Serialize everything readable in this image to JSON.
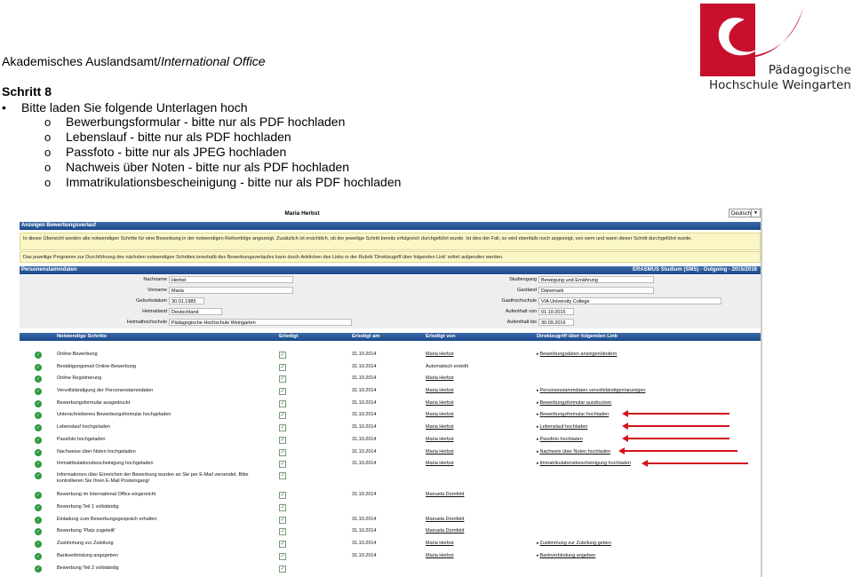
{
  "slide": {
    "office_prefix": "Akademisches Auslandsamt/",
    "office_italic": "International Office",
    "step_title": "Schritt 8",
    "intro": "Bitte laden Sie folgende Unterlagen hoch",
    "bullet_glyph": "•",
    "sub_glyph": "o",
    "items": [
      "Bewerbungsformular  - bitte nur als PDF hochladen",
      "Lebenslauf - bitte nur als PDF hochladen",
      "Passfoto - bitte nur als JPEG hochladen",
      "Nachweis über Noten - bitte nur als PDF hochladen",
      "Immatrikulationsbescheinigung - bitte nur als PDF hochladen"
    ]
  },
  "logo": {
    "line1": "Pädagogische",
    "line2": "Hochschule Weingarten",
    "color": "#c8102e"
  },
  "portal": {
    "user_name": "Maria Herbst",
    "language": "Deutsch",
    "section_title": "Anzeigen Bewerbungsverlauf",
    "info1": "In dieser Übersicht werden alle notwendigen Schritte für eine Bewerbung in der notwendigen Reihenfolge angezeigt. Zusätzlich ist ersichtlich, ob der jeweilige Schritt bereits erfolgreich durchgeführt wurde. Ist dies der Fall, so wird ebenfalls noch angezeigt, von wem und wann dieser Schritt durchgeführt wurde.",
    "info2": "Das jeweilige Programm zur Durchführung des nächsten notwendigen Schrittes innerhalb des Bewerbungsverlaufes kann durch Anklicken des Links in der Rubrik 'Direktzugriff über folgenden Link' sofort aufgerufen werden.",
    "person_header": "Personenstammdaten",
    "program_header": "ERASMUS Studium (SMS) - Outgoing - 2015/2016",
    "fields_left": [
      {
        "label": "Nachname",
        "value": "Herbst"
      },
      {
        "label": "Vorname",
        "value": "Maria"
      },
      {
        "label": "Geburtsdatum",
        "value": "30.01.1985"
      },
      {
        "label": "Heimatland",
        "value": "Deutschland"
      },
      {
        "label": "Heimathochschule",
        "value": "Pädagogische Hochschule Weingarten"
      }
    ],
    "fields_right": [
      {
        "label": "Studiengang",
        "value": "Bewegung und Ernährung"
      },
      {
        "label": "Gastland",
        "value": "Dänemark"
      },
      {
        "label": "Gasthochschule",
        "value": "VIA University College"
      },
      {
        "label": "Aufenthalt von",
        "value": "01.10.2015"
      },
      {
        "label": "Aufenthalt bis",
        "value": "30.09.2016"
      }
    ],
    "columns": {
      "step": "Notwendige Schritte",
      "done": "Erledigt",
      "done_on": "Erledigt am",
      "done_by": "Erledigt von",
      "link": "Direktzugriff über folgenden Link"
    },
    "ok_glyph": "✓",
    "check_glyph": "✓",
    "rows": [
      {
        "step": "Online-Bewerbung",
        "date": "31.10.2014",
        "by": "Maria Herbst",
        "link": "Bewerbungsdaten anzeigen/ändern"
      },
      {
        "step": "Bestätigungsmail Online-Bewerbung",
        "date": "31.10.2014",
        "by": "Automatisch erstellt",
        "link": ""
      },
      {
        "step": "Online Registrierung",
        "date": "31.10.2014",
        "by": "Maria Herbst",
        "link": ""
      },
      {
        "step": "Vervollständigung der Personenstammdaten",
        "date": "31.10.2014",
        "by": "Maria Herbst",
        "link": "Personenstammdaten vervollständigen/anzeigen"
      },
      {
        "step": "Bewerbungsformular ausgedruckt",
        "date": "31.10.2014",
        "by": "Maria Herbst",
        "link": "Bewerbungsformular ausdrucken"
      },
      {
        "step": "Unterschriebenes Bewerbungsformular hochgeladen",
        "date": "31.10.2014",
        "by": "Maria Herbst",
        "link": "Bewerbungsformular hochladen"
      },
      {
        "step": "Lebenslauf hochgeladen",
        "date": "31.10.2014",
        "by": "Maria Herbst",
        "link": "Lebenslauf hochladen"
      },
      {
        "step": "Passfoto hochgeladen",
        "date": "31.10.2014",
        "by": "Maria Herbst",
        "link": "Passfoto hochladen"
      },
      {
        "step": "Nachweise über Noten hochgeladen",
        "date": "31.10.2014",
        "by": "Maria Herbst",
        "link": "Nachweis über Noten hochladen"
      },
      {
        "step": "Immatrikulationsbescheinigung hochgeladen",
        "date": "31.10.2014",
        "by": "Maria Herbst",
        "link": "Immatrikulationsbescheinigung hochladen"
      },
      {
        "step": "Informationen über Einreichen der Bewerbung wurden an Sie per E-Mail versendet. Bitte kontrollieren Sie Ihren E-Mail Posteingang!",
        "date": "",
        "by": "",
        "link": ""
      },
      {
        "step": "Bewerbung im International Office eingereicht",
        "date": "31.10.2014",
        "by": "Manuela Dornfeld",
        "link": ""
      },
      {
        "step": "Bewerbung Teil 1 vollständig",
        "date": "",
        "by": "",
        "link": ""
      },
      {
        "step": "Einladung zum Bewerbungsgespräch erhalten",
        "date": "31.10.2014",
        "by": "Manuela Dornfeld",
        "link": ""
      },
      {
        "step": "Bewerbung 'Platz zugeteilt'",
        "date": "31.10.2014",
        "by": "Manuela Dornfeld",
        "link": ""
      },
      {
        "step": "Zustimmung zur Zuteilung",
        "date": "31.10.2014",
        "by": "Maria Herbst",
        "link": "Zustimmung zur Zuteilung geben"
      },
      {
        "step": "Bankverbindung angegeben",
        "date": "31.10.2014",
        "by": "Maria Herbst",
        "link": "Bankverbindung angeben"
      },
      {
        "step": "Bewerbung Teil 2 vollständig",
        "date": "",
        "by": "",
        "link": ""
      }
    ]
  }
}
